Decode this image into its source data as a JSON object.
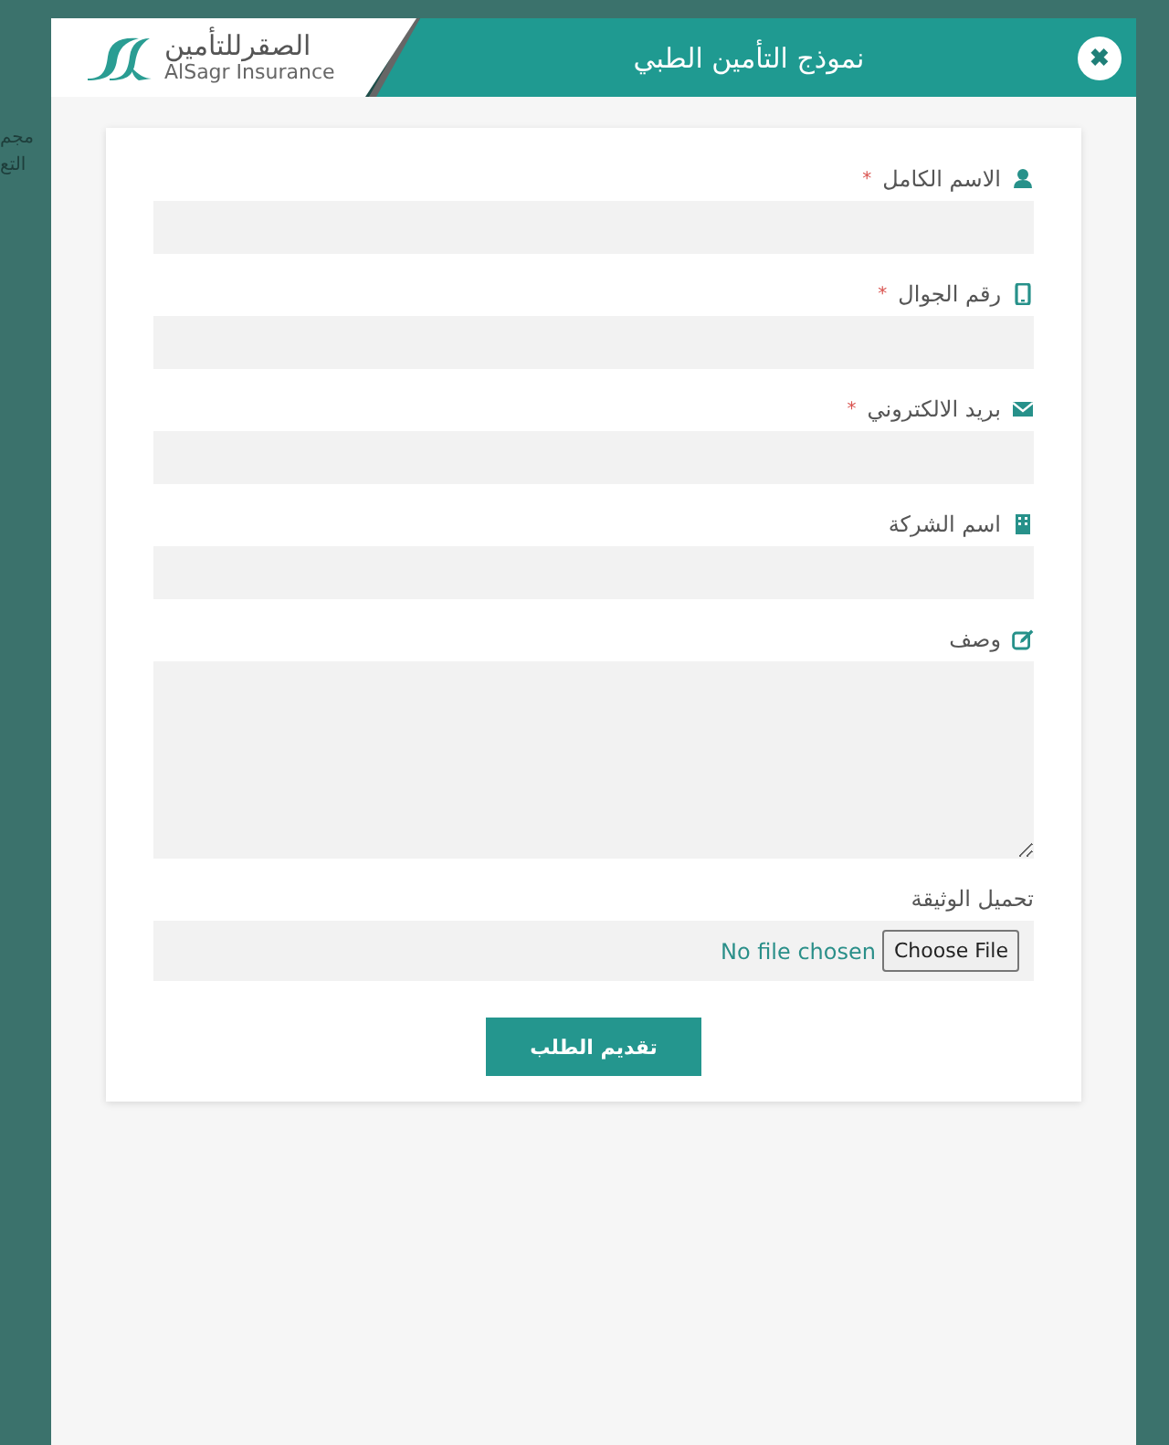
{
  "background_text": [
    "مجم",
    "التع"
  ],
  "modal": {
    "logo": {
      "arabic": "الصقرللتأمين",
      "english": "AlSagr Insurance"
    },
    "title": "نموذج التأمين الطبي",
    "close": "✖"
  },
  "form": {
    "fields": [
      {
        "kind": "input",
        "label": "الاسم الكامل",
        "required_mark": "*"
      },
      {
        "kind": "input",
        "label": "رقم الجوال",
        "required_mark": "*"
      },
      {
        "kind": "input",
        "label": "بريد الالكتروني",
        "required_mark": "*"
      },
      {
        "kind": "input",
        "label": "اسم الشركة"
      },
      {
        "kind": "textarea",
        "label": "وصف"
      },
      {
        "kind": "file",
        "label": "تحميل الوثيقة",
        "button": "Choose File",
        "status": "No file chosen"
      }
    ],
    "submit": "تقديم الطلب"
  }
}
